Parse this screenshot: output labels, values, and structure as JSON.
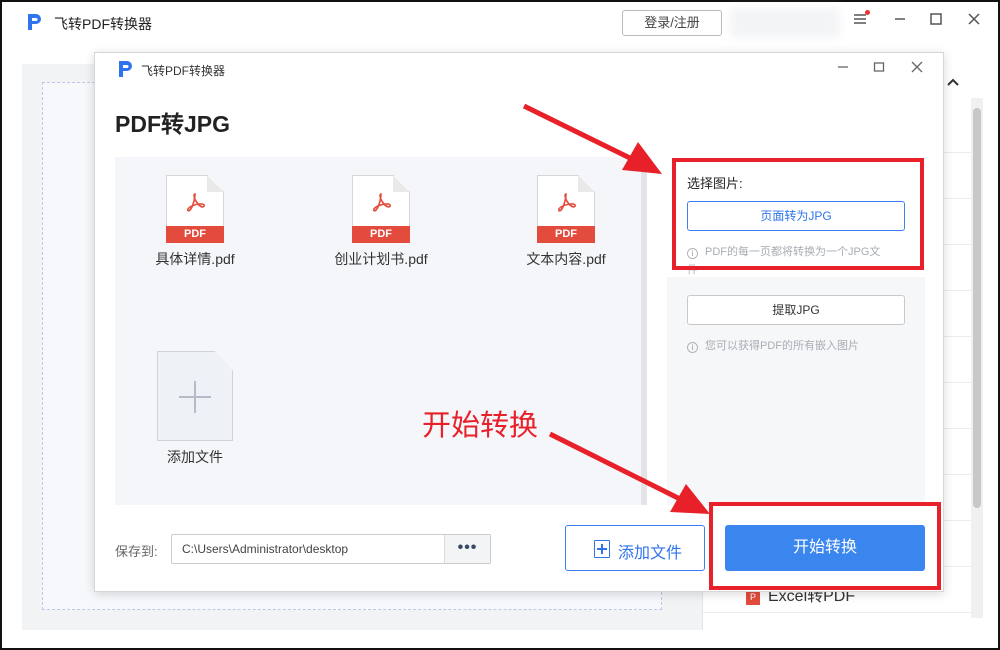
{
  "outer_window": {
    "title": "飞转PDF转换器",
    "login_label": "登录/注册"
  },
  "background_list": {
    "partial_item": "Excel转PDF"
  },
  "dialog": {
    "title": "飞转PDF转换器",
    "heading": "PDF转JPG",
    "files": [
      {
        "name": "具体详情.pdf",
        "tag": "PDF"
      },
      {
        "name": "创业计划书.pdf",
        "tag": "PDF"
      },
      {
        "name": "文本内容.pdf",
        "tag": "PDF"
      }
    ],
    "add_tile_label": "添加文件",
    "save_to_label": "保存到:",
    "save_path": "C:\\Users\\Administrator\\desktop",
    "more_label": "•••",
    "add_file_button": "添加文件",
    "start_button": "开始转换"
  },
  "options": {
    "select_label": "选择图片:",
    "page_to_jpg": "页面转为JPG",
    "page_to_jpg_hint_line1": "PDF的每一页都将转换为一个JPG文",
    "page_to_jpg_hint_line2": "件",
    "extract_jpg": "提取JPG",
    "extract_hint": "您可以获得PDF的所有嵌入图片"
  },
  "annotations": {
    "start_convert_text": "开始转换",
    "accent_color": "#e8202a"
  },
  "colors": {
    "primary": "#3a86ee",
    "pdf_red": "#e34b3c"
  }
}
